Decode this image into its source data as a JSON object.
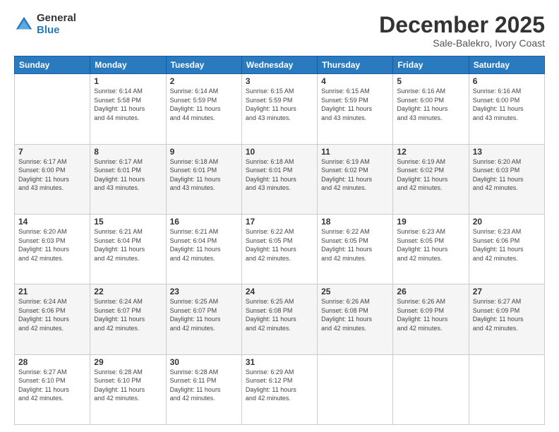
{
  "logo": {
    "general": "General",
    "blue": "Blue"
  },
  "header": {
    "title": "December 2025",
    "subtitle": "Sale-Balekro, Ivory Coast"
  },
  "days_of_week": [
    "Sunday",
    "Monday",
    "Tuesday",
    "Wednesday",
    "Thursday",
    "Friday",
    "Saturday"
  ],
  "weeks": [
    [
      {
        "day": "",
        "info": ""
      },
      {
        "day": "1",
        "info": "Sunrise: 6:14 AM\nSunset: 5:58 PM\nDaylight: 11 hours\nand 44 minutes."
      },
      {
        "day": "2",
        "info": "Sunrise: 6:14 AM\nSunset: 5:59 PM\nDaylight: 11 hours\nand 44 minutes."
      },
      {
        "day": "3",
        "info": "Sunrise: 6:15 AM\nSunset: 5:59 PM\nDaylight: 11 hours\nand 43 minutes."
      },
      {
        "day": "4",
        "info": "Sunrise: 6:15 AM\nSunset: 5:59 PM\nDaylight: 11 hours\nand 43 minutes."
      },
      {
        "day": "5",
        "info": "Sunrise: 6:16 AM\nSunset: 6:00 PM\nDaylight: 11 hours\nand 43 minutes."
      },
      {
        "day": "6",
        "info": "Sunrise: 6:16 AM\nSunset: 6:00 PM\nDaylight: 11 hours\nand 43 minutes."
      }
    ],
    [
      {
        "day": "7",
        "info": "Sunrise: 6:17 AM\nSunset: 6:00 PM\nDaylight: 11 hours\nand 43 minutes."
      },
      {
        "day": "8",
        "info": "Sunrise: 6:17 AM\nSunset: 6:01 PM\nDaylight: 11 hours\nand 43 minutes."
      },
      {
        "day": "9",
        "info": "Sunrise: 6:18 AM\nSunset: 6:01 PM\nDaylight: 11 hours\nand 43 minutes."
      },
      {
        "day": "10",
        "info": "Sunrise: 6:18 AM\nSunset: 6:01 PM\nDaylight: 11 hours\nand 43 minutes."
      },
      {
        "day": "11",
        "info": "Sunrise: 6:19 AM\nSunset: 6:02 PM\nDaylight: 11 hours\nand 42 minutes."
      },
      {
        "day": "12",
        "info": "Sunrise: 6:19 AM\nSunset: 6:02 PM\nDaylight: 11 hours\nand 42 minutes."
      },
      {
        "day": "13",
        "info": "Sunrise: 6:20 AM\nSunset: 6:03 PM\nDaylight: 11 hours\nand 42 minutes."
      }
    ],
    [
      {
        "day": "14",
        "info": "Sunrise: 6:20 AM\nSunset: 6:03 PM\nDaylight: 11 hours\nand 42 minutes."
      },
      {
        "day": "15",
        "info": "Sunrise: 6:21 AM\nSunset: 6:04 PM\nDaylight: 11 hours\nand 42 minutes."
      },
      {
        "day": "16",
        "info": "Sunrise: 6:21 AM\nSunset: 6:04 PM\nDaylight: 11 hours\nand 42 minutes."
      },
      {
        "day": "17",
        "info": "Sunrise: 6:22 AM\nSunset: 6:05 PM\nDaylight: 11 hours\nand 42 minutes."
      },
      {
        "day": "18",
        "info": "Sunrise: 6:22 AM\nSunset: 6:05 PM\nDaylight: 11 hours\nand 42 minutes."
      },
      {
        "day": "19",
        "info": "Sunrise: 6:23 AM\nSunset: 6:05 PM\nDaylight: 11 hours\nand 42 minutes."
      },
      {
        "day": "20",
        "info": "Sunrise: 6:23 AM\nSunset: 6:06 PM\nDaylight: 11 hours\nand 42 minutes."
      }
    ],
    [
      {
        "day": "21",
        "info": "Sunrise: 6:24 AM\nSunset: 6:06 PM\nDaylight: 11 hours\nand 42 minutes."
      },
      {
        "day": "22",
        "info": "Sunrise: 6:24 AM\nSunset: 6:07 PM\nDaylight: 11 hours\nand 42 minutes."
      },
      {
        "day": "23",
        "info": "Sunrise: 6:25 AM\nSunset: 6:07 PM\nDaylight: 11 hours\nand 42 minutes."
      },
      {
        "day": "24",
        "info": "Sunrise: 6:25 AM\nSunset: 6:08 PM\nDaylight: 11 hours\nand 42 minutes."
      },
      {
        "day": "25",
        "info": "Sunrise: 6:26 AM\nSunset: 6:08 PM\nDaylight: 11 hours\nand 42 minutes."
      },
      {
        "day": "26",
        "info": "Sunrise: 6:26 AM\nSunset: 6:09 PM\nDaylight: 11 hours\nand 42 minutes."
      },
      {
        "day": "27",
        "info": "Sunrise: 6:27 AM\nSunset: 6:09 PM\nDaylight: 11 hours\nand 42 minutes."
      }
    ],
    [
      {
        "day": "28",
        "info": "Sunrise: 6:27 AM\nSunset: 6:10 PM\nDaylight: 11 hours\nand 42 minutes."
      },
      {
        "day": "29",
        "info": "Sunrise: 6:28 AM\nSunset: 6:10 PM\nDaylight: 11 hours\nand 42 minutes."
      },
      {
        "day": "30",
        "info": "Sunrise: 6:28 AM\nSunset: 6:11 PM\nDaylight: 11 hours\nand 42 minutes."
      },
      {
        "day": "31",
        "info": "Sunrise: 6:29 AM\nSunset: 6:12 PM\nDaylight: 11 hours\nand 42 minutes."
      },
      {
        "day": "",
        "info": ""
      },
      {
        "day": "",
        "info": ""
      },
      {
        "day": "",
        "info": ""
      }
    ]
  ]
}
